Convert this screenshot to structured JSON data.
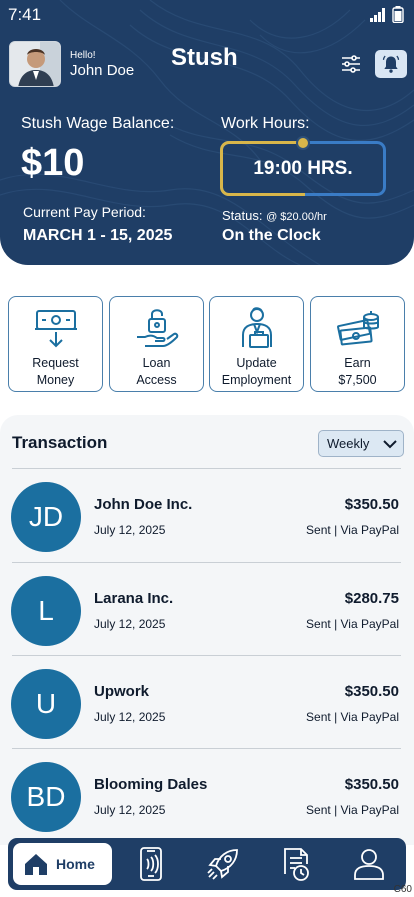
{
  "status_bar": {
    "time": "7:41"
  },
  "header": {
    "greeting": "Hello!",
    "user_name": "John Doe",
    "app_title": "Stush",
    "wage_balance_label": "Stush Wage Balance:",
    "wage_balance_value": "$10",
    "pay_period_label": "Current Pay Period:",
    "pay_period_value": "MARCH 1 - 15, 2025",
    "work_hours_label": "Work Hours:",
    "work_hours_value": "19:00 HRS.",
    "status_label": "Status: ",
    "status_rate": "@ $20.00/hr",
    "status_value": "On the Clock"
  },
  "actions": [
    {
      "label": "Request\nMoney",
      "icon": "money-withdraw-icon"
    },
    {
      "label": "Loan\nAccess",
      "icon": "lock-hand-icon"
    },
    {
      "label": "Update\nEmployment",
      "icon": "employee-briefcase-icon"
    },
    {
      "label": "Earn\n$7,500",
      "icon": "money-stack-icon"
    }
  ],
  "transactions": {
    "title": "Transaction",
    "period_selected": "Weekly",
    "items": [
      {
        "initials": "JD",
        "name": "John Doe Inc.",
        "date": "July 12, 2025",
        "amount": "$350.50",
        "method": "Sent | Via PayPal"
      },
      {
        "initials": "L",
        "name": "Larana Inc.",
        "date": "July 12, 2025",
        "amount": "$280.75",
        "method": "Sent | Via PayPal"
      },
      {
        "initials": "U",
        "name": "Upwork",
        "date": "July 12, 2025",
        "amount": "$350.50",
        "method": "Sent | Via PayPal"
      },
      {
        "initials": "BD",
        "name": "Blooming Dales",
        "date": "July 12, 2025",
        "amount": "$350.50",
        "method": "Sent | Via PayPal"
      }
    ]
  },
  "bottom_nav": {
    "home_label": "Home",
    "items": [
      "phone-nfc-icon",
      "rocket-icon",
      "document-clock-icon",
      "profile-icon"
    ]
  },
  "corner_tag": "C60",
  "colors": {
    "primary": "#1f3e66",
    "avatar_bg": "#1b6fa0",
    "accent_gold": "#d8b64a",
    "accent_blue": "#3a7cc6"
  }
}
